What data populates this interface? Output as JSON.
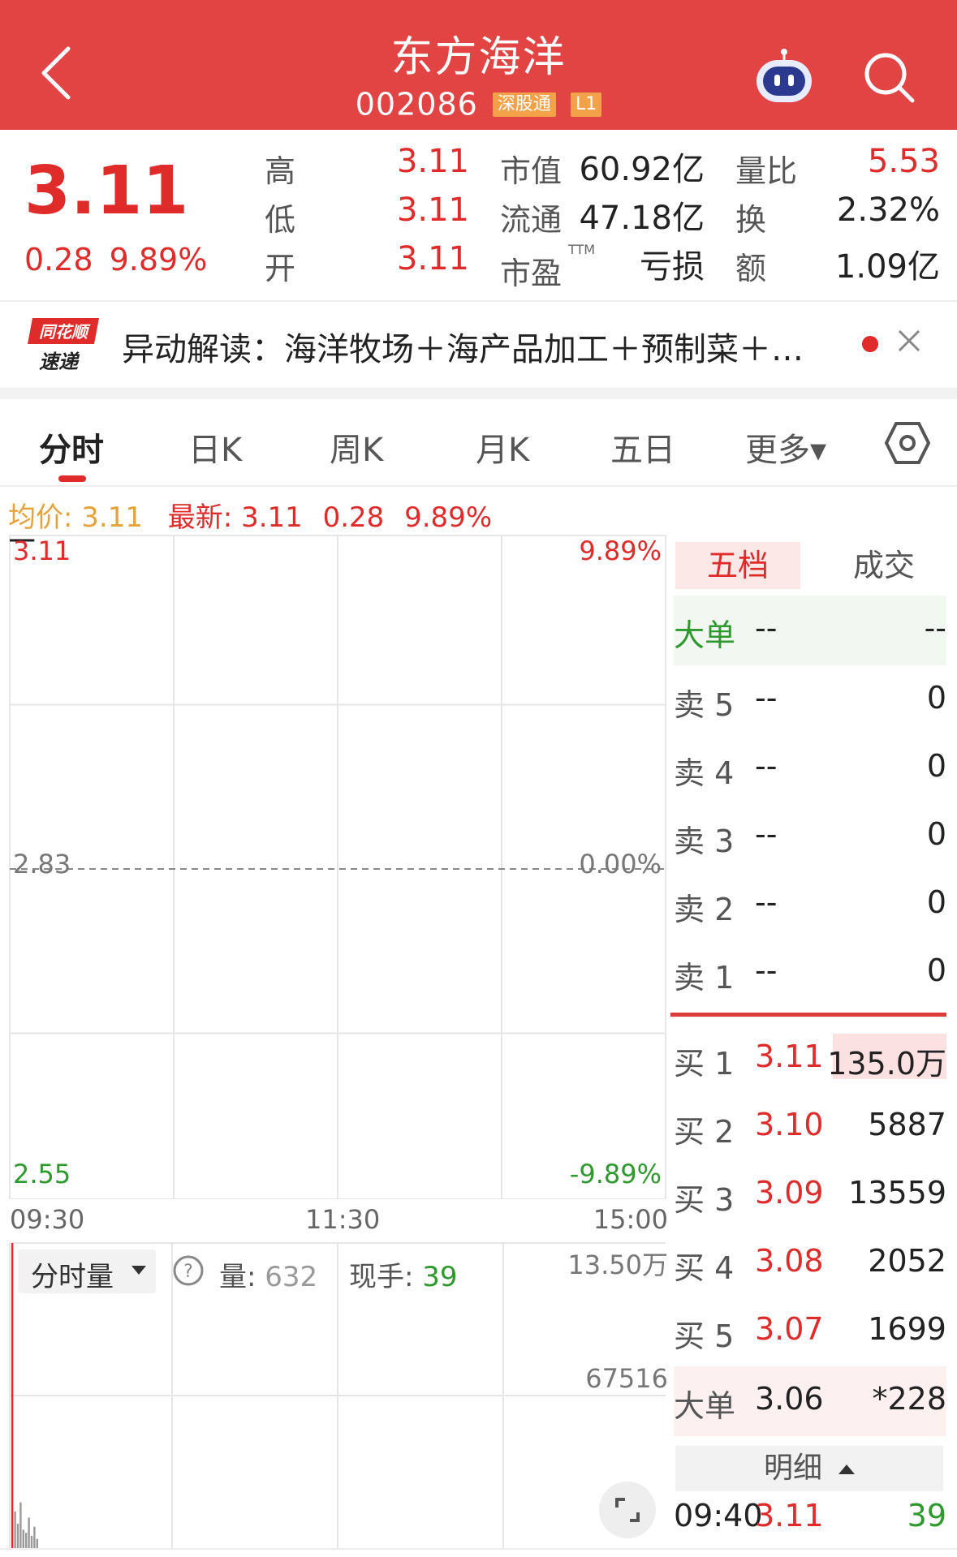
{
  "header": {
    "title": "东方海洋",
    "code": "002086",
    "tags": [
      "深股通",
      "L1"
    ]
  },
  "quote": {
    "price": "3.11",
    "change": "0.28",
    "change_pct": "9.89%",
    "stats": [
      {
        "label": "高",
        "value": "3.11",
        "color": "red"
      },
      {
        "label": "低",
        "value": "3.11",
        "color": "red"
      },
      {
        "label": "开",
        "value": "3.11",
        "color": "red"
      }
    ],
    "stats2": [
      {
        "label": "市值",
        "value": "60.92亿"
      },
      {
        "label": "流通",
        "value": "47.18亿"
      },
      {
        "label": "市盈",
        "sup": "TTM",
        "value": "亏损"
      }
    ],
    "stats3": [
      {
        "label": "量比",
        "value": "5.53",
        "color": "red"
      },
      {
        "label": "换",
        "value": "2.32%",
        "color": "dark"
      },
      {
        "label": "额",
        "value": "1.09亿",
        "color": "dark"
      }
    ]
  },
  "news": {
    "logo_line1": "同花顺",
    "logo_line2": "速递",
    "text": "异动解读：海洋牧场＋海产品加工＋预制菜＋…"
  },
  "tabs": [
    "分时",
    "日K",
    "周K",
    "月K",
    "五日",
    "更多▾"
  ],
  "info_line": {
    "avg_label": "均价:",
    "avg_value": "3.11",
    "latest_label": "最新:",
    "latest_value": "3.11",
    "latest_change": "0.28",
    "latest_pct": "9.89%"
  },
  "chart_data": {
    "type": "line",
    "y_left_ticks": [
      "3.11",
      "2.83",
      "2.55"
    ],
    "y_right_ticks": [
      "9.89%",
      "0.00%",
      "-9.89%"
    ],
    "x_ticks": [
      "09:30",
      "11:30",
      "15:00"
    ],
    "ylim": [
      2.55,
      3.11
    ],
    "prev_close": 2.83,
    "series": [
      {
        "values": [
          3.11,
          3.11,
          3.11,
          3.11,
          3.11,
          3.11,
          3.11,
          3.11,
          3.11,
          3.11
        ]
      }
    ]
  },
  "volume": {
    "dropdown": "分时量",
    "vol_label": "量:",
    "vol_value": "632",
    "now_label": "现手:",
    "now_value": "39",
    "axis_top": "13.50万",
    "axis_mid": "67516",
    "bars": [
      1.0,
      0.12,
      0.08,
      0.15,
      0.06,
      0.05,
      0.1,
      0.04,
      0.07,
      0.03
    ]
  },
  "orderbook": {
    "tab_active": "五档",
    "tab_other": "成交",
    "big_top": {
      "label": "大单",
      "price": "--",
      "vol": "--"
    },
    "sells": [
      {
        "label": "卖 5",
        "price": "--",
        "vol": "0"
      },
      {
        "label": "卖 4",
        "price": "--",
        "vol": "0"
      },
      {
        "label": "卖 3",
        "price": "--",
        "vol": "0"
      },
      {
        "label": "卖 2",
        "price": "--",
        "vol": "0"
      },
      {
        "label": "卖 1",
        "price": "--",
        "vol": "0"
      }
    ],
    "buys": [
      {
        "label": "买 1",
        "price": "3.11",
        "vol": "135.0万"
      },
      {
        "label": "买 2",
        "price": "3.10",
        "vol": "5887"
      },
      {
        "label": "买 3",
        "price": "3.09",
        "vol": "13559"
      },
      {
        "label": "买 4",
        "price": "3.08",
        "vol": "2052"
      },
      {
        "label": "买 5",
        "price": "3.07",
        "vol": "1699"
      }
    ],
    "big_bottom": {
      "label": "大单",
      "price": "3.06",
      "vol": "*228"
    },
    "detail_label": "明细",
    "tick": {
      "time": "09:40",
      "price": "3.11",
      "vol": "39"
    }
  }
}
